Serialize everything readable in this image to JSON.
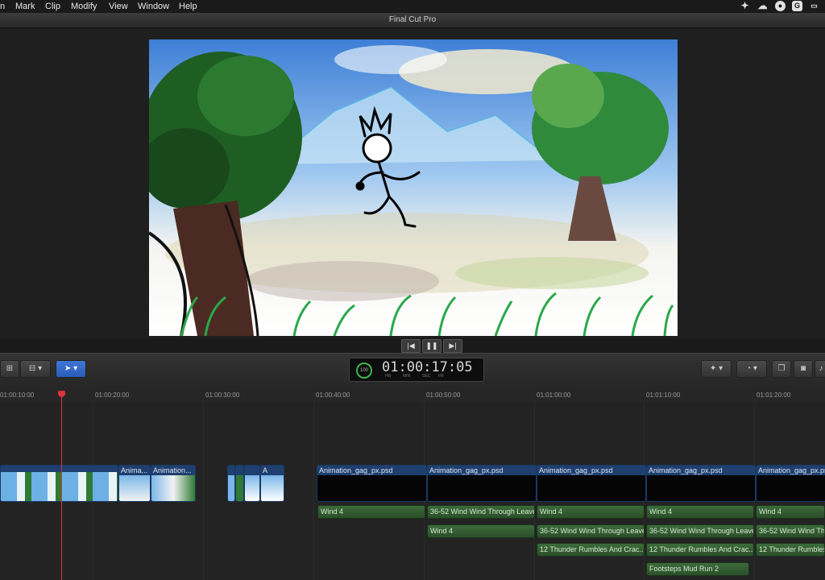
{
  "menubar": {
    "items": [
      "n",
      "Mark",
      "Clip",
      "Modify",
      "View",
      "Window",
      "Help"
    ]
  },
  "window": {
    "title": "Final Cut Pro"
  },
  "transport": {
    "prev": "|◀",
    "pause": "❚❚",
    "next": "▶|"
  },
  "toolbar": {
    "timecode": "01:00:17:05",
    "percent": "100",
    "units": [
      "HR",
      "MIN",
      "SEC",
      "FR"
    ],
    "select_tool": "arrow-select-tool",
    "accent": "#3b73d8"
  },
  "ruler": {
    "ticks": [
      "01:00:10:00",
      "01:00:20:00",
      "01:00:30:00",
      "01:00:40:00",
      "01:00:50:00",
      "01:01:00:00",
      "01:01:10:00",
      "01:01:20:00"
    ]
  },
  "clips": {
    "video": [
      "Anima...",
      "Animation...",
      "A",
      "Animation_gag_px.psd",
      "Animation_gag_px.psd",
      "Animation_gag_px.psd",
      "Animation_gag_px.psd",
      "Animation_gag_px.psd"
    ],
    "audio_row1": [
      "Wind 4",
      "36-52 Wind Wind Through Leaves",
      "Wind 4",
      "Wind 4",
      "Wind 4"
    ],
    "audio_row2": [
      "Wind 4",
      "36-52 Wind Wind Through Leaves",
      "36-52 Wind Wind Through Leaves",
      "36-52 Wind Wind Thro"
    ],
    "audio_row3": [
      "12 Thunder Rumbles And Crac...",
      "12 Thunder Rumbles And Crac...",
      "12 Thunder Rumbles And"
    ],
    "audio_row4": [
      "Footsteps Mud Run 2"
    ]
  }
}
